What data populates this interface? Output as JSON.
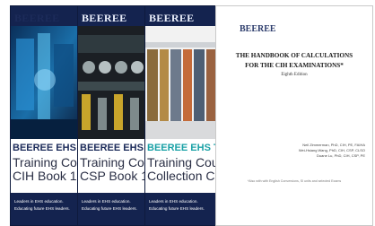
{
  "books": [
    {
      "brand": "BEEREE",
      "series": "BEEREE EHS T",
      "title_line1": "Training Cours",
      "title_line2": "CIH Book 1",
      "tagline_line1": "Leaders in EHS education.",
      "tagline_line2": "Educating future EHS leaders."
    },
    {
      "brand": "BEEREE",
      "series": "BEEREE EHS",
      "title_line1": "Training Cours",
      "title_line2": "CSP Book 1",
      "tagline_line1": "Leaders in EHS education.",
      "tagline_line2": "Educating future EHS leaders."
    },
    {
      "brand": "BEEREE",
      "series": "BEEREE EHS T",
      "title_line1": "Training Cours",
      "title_line2": "Collection CSP",
      "tagline_line1": "Leaders in EHS education.",
      "tagline_line2": "Educating future EHS leaders."
    }
  ],
  "handbook": {
    "brand": "BEEREE",
    "title_line1": "THE HANDBOOK OF CALCULATIONS",
    "title_line2": "FOR THE CIH EXAMINATIONS*",
    "edition": "Eighth Edition",
    "author_line1": "Neil Zimmerman, PhD, CIH, PE, FAIHA",
    "author_line2": "Wei-Hsiang Wang, PhD, CIH, CSP, CLSO",
    "author_line3": "Duane Lu, PhD, CIH, CSP, PE",
    "footer": "*Also with with English Conversions, SI units and selected Exams"
  },
  "colors": {
    "navy": "#14234f",
    "teal": "#1aa1a6",
    "brand_navy": "#1c2b5a"
  }
}
